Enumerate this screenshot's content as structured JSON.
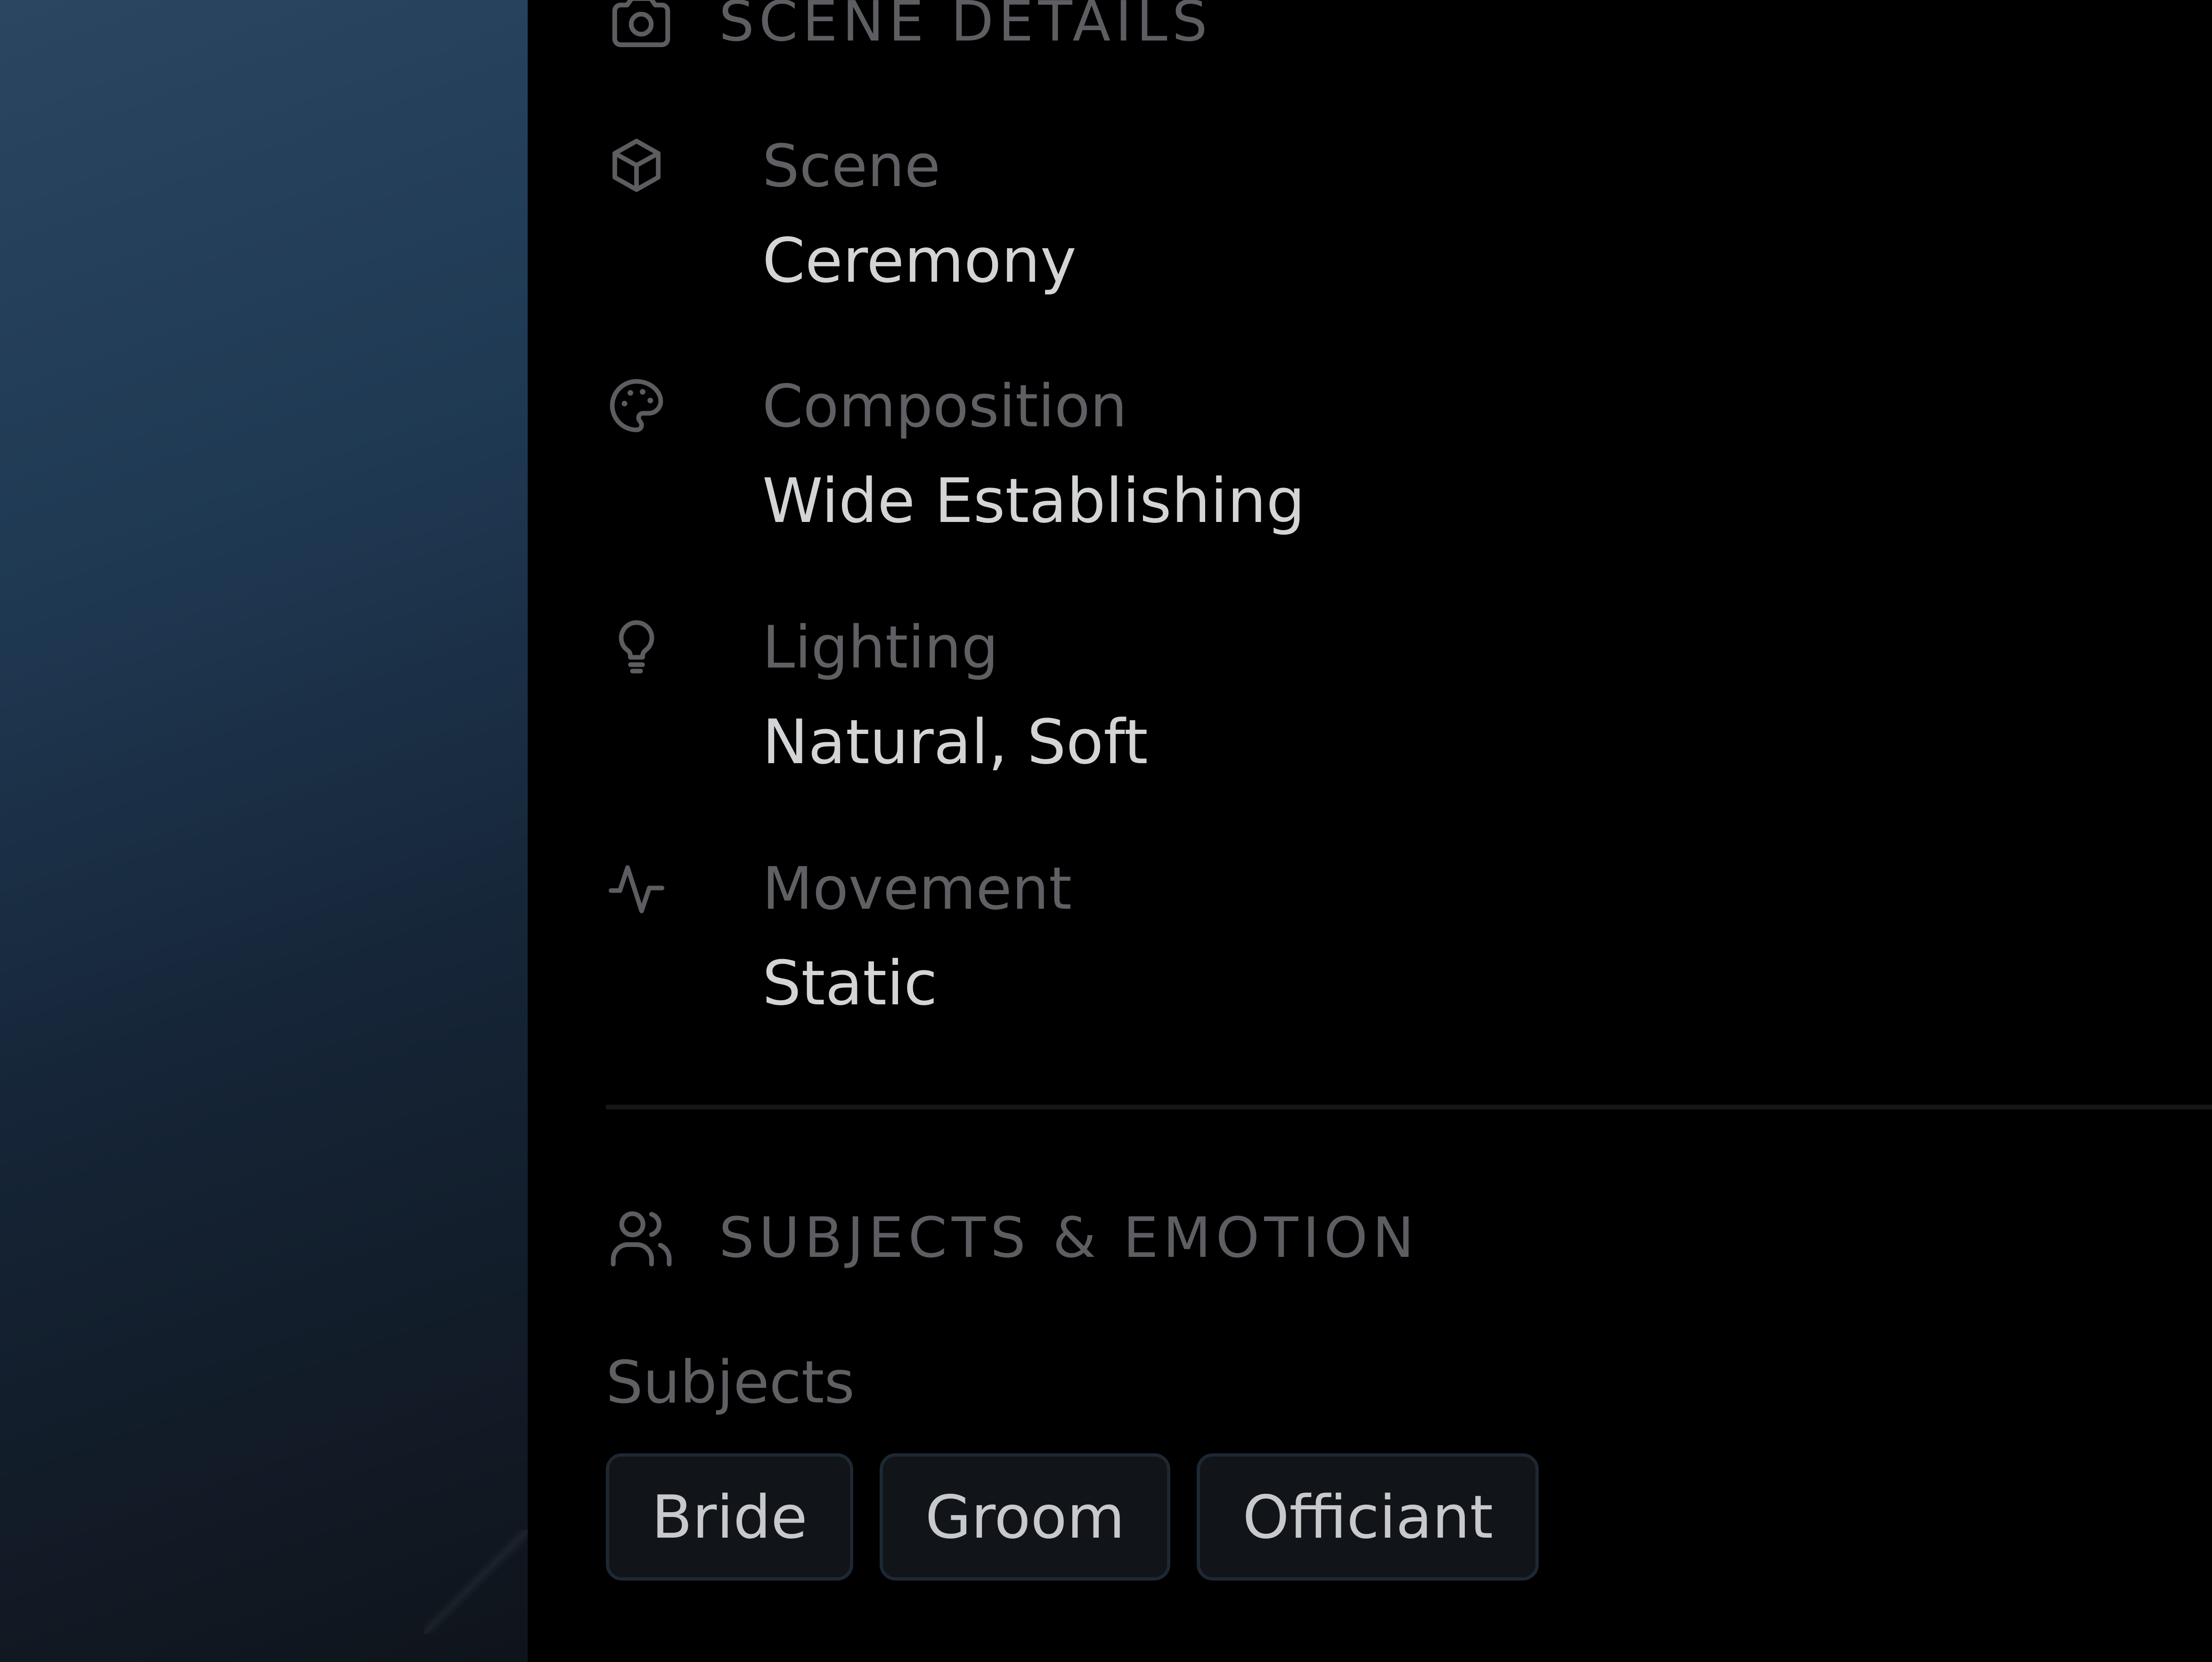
{
  "colors": {
    "panel_bg": "#000000",
    "header_text": "#5d5e62",
    "label_text": "#5f6063",
    "value_text": "#d3d4d6",
    "icon_stroke": "#5c5d60",
    "chip_bg": "#111418",
    "chip_border": "#1d2833",
    "chip_text": "#c8c9cc",
    "preview_gradient": [
      "#2a4661",
      "#152436",
      "#0f141b"
    ]
  },
  "scene_details": {
    "title": "SCENE DETAILS",
    "icon": "camera-icon",
    "rows": [
      {
        "icon": "cube-icon",
        "label": "Scene",
        "value": "Ceremony"
      },
      {
        "icon": "palette-icon",
        "label": "Composition",
        "value": "Wide Establishing"
      },
      {
        "icon": "lightbulb-icon",
        "label": "Lighting",
        "value": "Natural, Soft"
      },
      {
        "icon": "activity-icon",
        "label": "Movement",
        "value": "Static"
      }
    ]
  },
  "subjects_emotion": {
    "title": "SUBJECTS & EMOTION",
    "icon": "users-icon",
    "subjects_label": "Subjects",
    "subjects": [
      "Bride",
      "Groom",
      "Officiant"
    ]
  }
}
